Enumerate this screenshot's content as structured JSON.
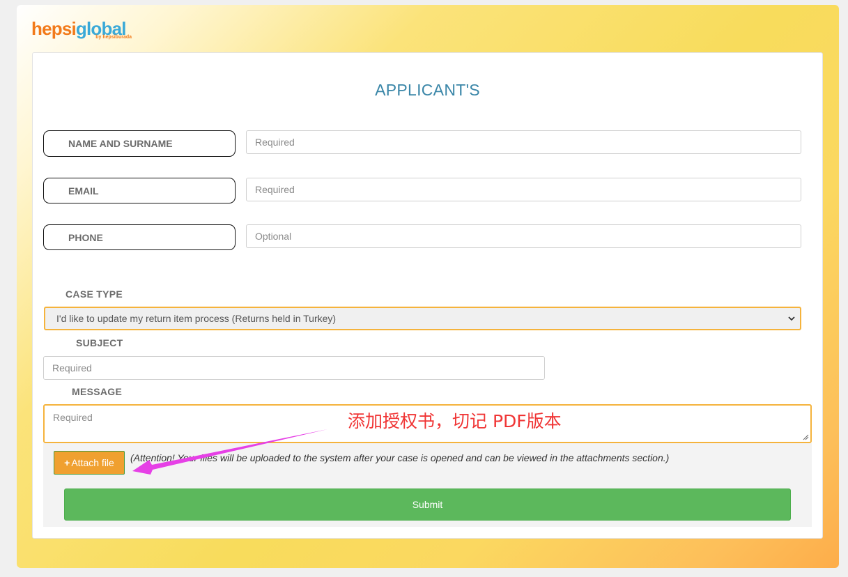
{
  "logo": {
    "part1": "hepsi",
    "part2": "global",
    "sub": "by hepsiburada"
  },
  "form": {
    "title": "APPLICANT'S",
    "fields": [
      {
        "label": "NAME AND SURNAME",
        "placeholder": "Required"
      },
      {
        "label": "EMAIL",
        "placeholder": "Required"
      },
      {
        "label": "PHONE",
        "placeholder": "Optional"
      }
    ],
    "case_type": {
      "label": "CASE TYPE",
      "selected": "I'd like to update my return item process (Returns held in Turkey)"
    },
    "subject": {
      "label": "SUBJECT",
      "placeholder": "Required"
    },
    "message": {
      "label": "MESSAGE",
      "placeholder": "Required"
    },
    "attach": {
      "icon": "plus-icon",
      "plus": "+",
      "label": "Attach file",
      "notice": "(Attention! Your files will be uploaded to the system after your case is opened and can be viewed in the attachments section.)"
    },
    "submit_label": "Submit"
  },
  "annotation": {
    "text": "添加授权书，切记 PDF版本",
    "color": "#f03535",
    "arrow_color": "#e640e6"
  },
  "colors": {
    "title": "#3a86a8",
    "focus_border": "#f5b33c",
    "attach_bg": "#f0a030",
    "submit_bg": "#5cb85c"
  }
}
